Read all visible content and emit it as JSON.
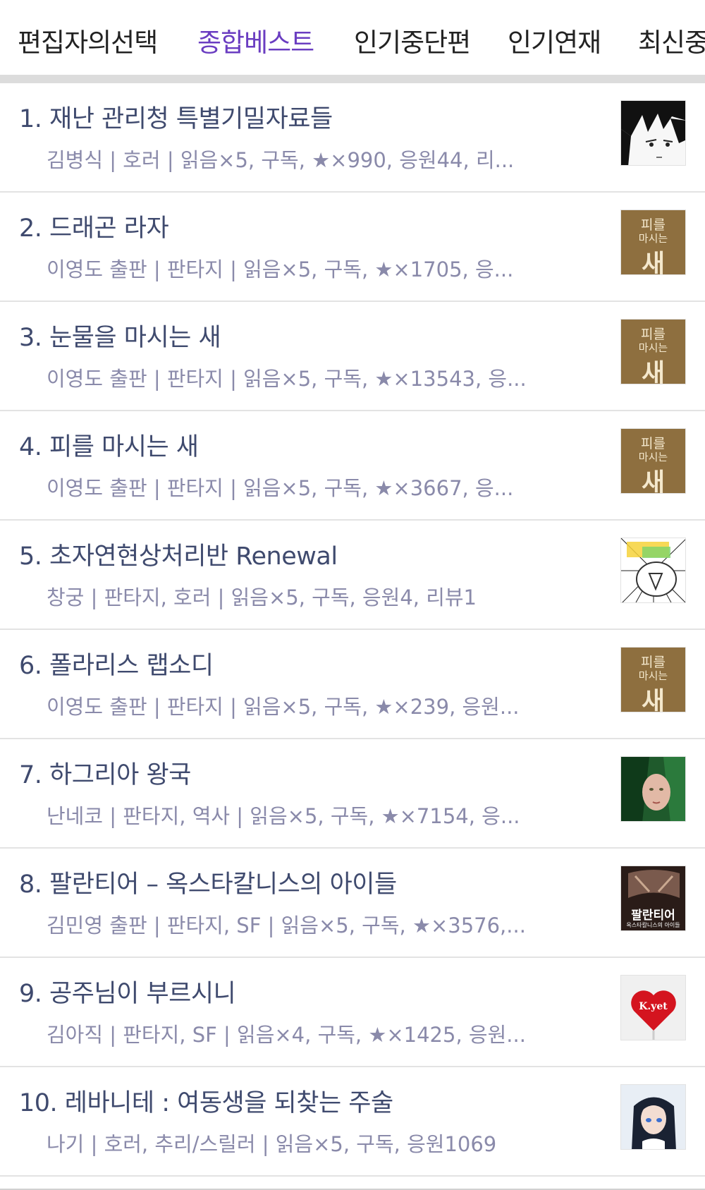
{
  "tabs": [
    {
      "label": "편집자의선택"
    },
    {
      "label": "종합베스트"
    },
    {
      "label": "인기중단편"
    },
    {
      "label": "인기연재"
    },
    {
      "label": "최신중"
    }
  ],
  "items": [
    {
      "title": "1. 재난 관리청 특별기밀자료들",
      "meta": "김병식 | 호러 | 읽음×5, 구독, ★×990, 응원44, 리...",
      "thumb": "manga-face"
    },
    {
      "title": "2. 드래곤 라자",
      "meta": "이영도 출판 | 판타지 | 읽음×5, 구독, ★×1705, 응...",
      "thumb": "book-cover",
      "cover_text": [
        "피를",
        "마시는",
        "새"
      ]
    },
    {
      "title": "3. 눈물을 마시는 새",
      "meta": "이영도 출판 | 판타지 | 읽음×5, 구독, ★×13543, 응...",
      "thumb": "book-cover",
      "cover_text": [
        "피를",
        "마시는",
        "새"
      ]
    },
    {
      "title": "4. 피를 마시는 새",
      "meta": "이영도 출판 | 판타지 | 읽음×5, 구독, ★×3667, 응...",
      "thumb": "book-cover",
      "cover_text": [
        "피를",
        "마시는",
        "새"
      ]
    },
    {
      "title": "5. 초자연현상처리반 Renewal",
      "meta": "창궁 | 판타지, 호러 | 읽음×5, 구독, 응원4, 리뷰1",
      "thumb": "cartoon-ghost"
    },
    {
      "title": "6. 폴라리스 랩소디",
      "meta": "이영도 출판 | 판타지 | 읽음×5, 구독, ★×239, 응원...",
      "thumb": "book-cover",
      "cover_text": [
        "피를",
        "마시는",
        "새"
      ]
    },
    {
      "title": "7. 하그리아 왕국",
      "meta": "난네코 | 판타지, 역사 | 읽음×5, 구독, ★×7154, 응...",
      "thumb": "portrait-green"
    },
    {
      "title": "8. 팔란티어 – 옥스타칼니스의 아이들",
      "meta": "김민영 출판 | 판타지, SF | 읽음×5, 구독, ★×3576,...",
      "thumb": "palantir-cover",
      "cover_text": [
        "팔란티어",
        "옥스타칼니스의 아이들"
      ]
    },
    {
      "title": "9. 공주님이 부르시니",
      "meta": "김아직 | 판타지, SF | 읽음×4, 구독, ★×1425, 응원...",
      "thumb": "heart-lollipop",
      "cover_text": [
        "K.yet"
      ]
    },
    {
      "title": "10. 레바니테 : 여동생을 되찾는 주술",
      "meta": "나기 | 호러, 추리/스릴러 | 읽음×5, 구독, 응원1069",
      "thumb": "anime-girl"
    }
  ]
}
